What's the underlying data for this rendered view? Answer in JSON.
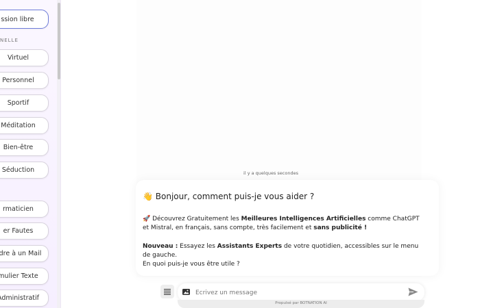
{
  "sidebar": {
    "top_button": "ssion libre",
    "section_label": "NELLE",
    "items": [
      {
        "label": "Virtuel"
      },
      {
        "label": "Personnel"
      },
      {
        "label": "Sportif"
      },
      {
        "label": "Méditation"
      },
      {
        "label": "Bien-être"
      },
      {
        "label": "Séduction"
      },
      {
        "label": "rmaticien"
      },
      {
        "label": "er Fautes"
      },
      {
        "label": "ndre à un Mail"
      },
      {
        "label": "mulier Texte"
      },
      {
        "label": "Administratif"
      }
    ]
  },
  "chat": {
    "timestamp": "il y a quelques secondes",
    "greeting_emoji": "👋",
    "greeting": "Bonjour, comment puis-je vous aider ?",
    "p1": {
      "emoji": "🚀",
      "t1": "Découvrez Gratuitement les ",
      "b1": "Meilleures Intelligences Artificielles",
      "t2": " comme ChatGPT et Mistral, en français, sans compte, très facilement et ",
      "b2": "sans publicité !"
    },
    "p2": {
      "b1": "Nouveau :",
      "t1": " Essayez les ",
      "b2": "Assistants Experts",
      "t2": " de votre quotidien, accessibles sur le menu de gauche."
    },
    "p3": "En quoi puis-je vous être utile ?"
  },
  "input": {
    "placeholder": "Écrivez un message",
    "footer": "Propulsé par BOTNATION AI"
  },
  "colors": {
    "accent_border": "#6c7bd8",
    "sidebar_bg": "#f6efff"
  }
}
